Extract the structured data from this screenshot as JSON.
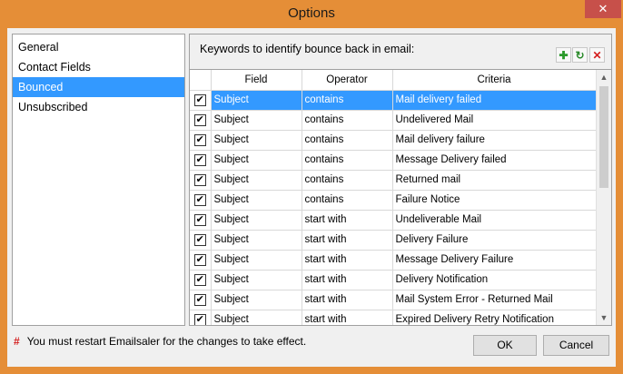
{
  "window": {
    "title": "Options",
    "close_glyph": "✕"
  },
  "sidebar": {
    "items": [
      {
        "label": "General",
        "selected": false
      },
      {
        "label": "Contact Fields",
        "selected": false
      },
      {
        "label": "Bounced",
        "selected": true
      },
      {
        "label": "Unsubscribed",
        "selected": false
      }
    ]
  },
  "panel": {
    "title": "Keywords to identify bounce back in email:",
    "toolbar": {
      "add_icon": "plus-icon",
      "refresh_icon": "refresh-icon",
      "delete_icon": "delete-icon"
    }
  },
  "grid": {
    "columns": [
      "",
      "Field",
      "Operator",
      "Criteria"
    ],
    "rows": [
      {
        "checked": true,
        "field": "Subject",
        "operator": "contains",
        "criteria": "Mail delivery failed",
        "selected": true
      },
      {
        "checked": true,
        "field": "Subject",
        "operator": "contains",
        "criteria": "Undelivered Mail"
      },
      {
        "checked": true,
        "field": "Subject",
        "operator": "contains",
        "criteria": "Mail delivery failure"
      },
      {
        "checked": true,
        "field": "Subject",
        "operator": "contains",
        "criteria": "Message Delivery failed"
      },
      {
        "checked": true,
        "field": "Subject",
        "operator": "contains",
        "criteria": "Returned mail"
      },
      {
        "checked": true,
        "field": "Subject",
        "operator": "contains",
        "criteria": "Failure Notice"
      },
      {
        "checked": true,
        "field": "Subject",
        "operator": "start with",
        "criteria": "Undeliverable Mail"
      },
      {
        "checked": true,
        "field": "Subject",
        "operator": "start with",
        "criteria": "Delivery Failure"
      },
      {
        "checked": true,
        "field": "Subject",
        "operator": "start with",
        "criteria": "Message Delivery Failure"
      },
      {
        "checked": true,
        "field": "Subject",
        "operator": "start with",
        "criteria": "Delivery Notification"
      },
      {
        "checked": true,
        "field": "Subject",
        "operator": "start with",
        "criteria": "Mail System Error - Returned Mail"
      },
      {
        "checked": true,
        "field": "Subject",
        "operator": "start with",
        "criteria": "Expired Delivery Retry Notification"
      }
    ]
  },
  "footer": {
    "note_marker": "#",
    "note": "You must restart Emailsaler for the changes to take effect.",
    "ok_label": "OK",
    "cancel_label": "Cancel"
  },
  "colors": {
    "title_bar": "#e58e37",
    "selection": "#3399ff",
    "close_button": "#c7504a"
  }
}
